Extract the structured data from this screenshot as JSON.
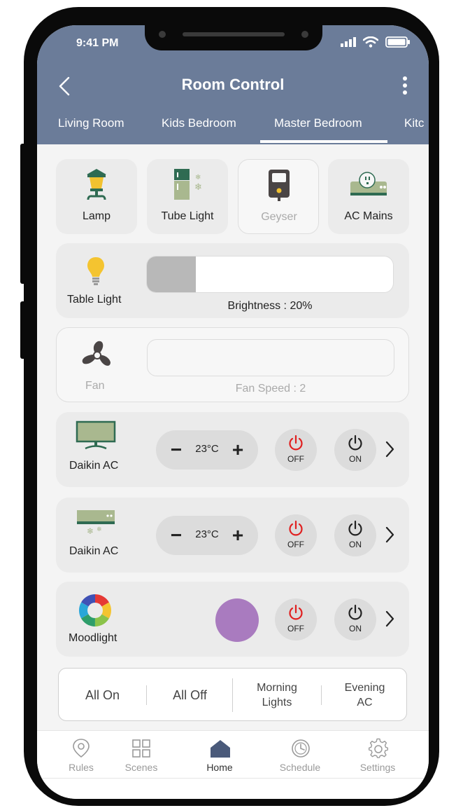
{
  "status": {
    "time": "9:41 PM"
  },
  "header": {
    "title": "Room Control"
  },
  "tabs": [
    {
      "label": "Living Room"
    },
    {
      "label": "Kids Bedroom"
    },
    {
      "label": "Master Bedroom",
      "active": true
    },
    {
      "label": "Kitc"
    }
  ],
  "devices": [
    {
      "label": "Lamp",
      "icon": "lamp-icon"
    },
    {
      "label": "Tube Light",
      "icon": "fridge-icon"
    },
    {
      "label": "Geyser",
      "icon": "geyser-icon",
      "state": "off"
    },
    {
      "label": "AC Mains",
      "icon": "ac-mains-icon"
    }
  ],
  "table_light": {
    "label": "Table Light",
    "caption": "Brightness : 20%",
    "level": 0.2
  },
  "fan": {
    "label": "Fan",
    "caption": "Fan Speed : 2",
    "state": "off"
  },
  "ac_units": [
    {
      "label": "Daikin AC",
      "temp": "23",
      "unit": "°C",
      "minus": "−",
      "plus": "+",
      "off_label": "OFF",
      "on_label": "ON",
      "icon": "monitor-icon"
    },
    {
      "label": "Daikin AC",
      "temp": "23",
      "unit": "°C",
      "minus": "−",
      "plus": "+",
      "off_label": "OFF",
      "on_label": "ON",
      "icon": "split-ac-icon"
    }
  ],
  "moodlight": {
    "label": "Moodlight",
    "off_label": "OFF",
    "on_label": "ON",
    "color": "#a97bbf"
  },
  "quick_actions": [
    {
      "label": "All On"
    },
    {
      "label": "All Off"
    },
    {
      "label": "Morning\nLights"
    },
    {
      "label": "Evening\nAC"
    }
  ],
  "bottom_nav": [
    {
      "label": "Rules",
      "icon": "location-pin-icon"
    },
    {
      "label": "Scenes",
      "icon": "grid-icon"
    },
    {
      "label": "Home",
      "icon": "home-icon",
      "active": true
    },
    {
      "label": "Schedule",
      "icon": "clock-icon"
    },
    {
      "label": "Settings",
      "icon": "gear-icon"
    }
  ],
  "colors": {
    "header": "#6b7c99",
    "power_off": "#e02020",
    "accent_home": "#4a5a7a"
  }
}
